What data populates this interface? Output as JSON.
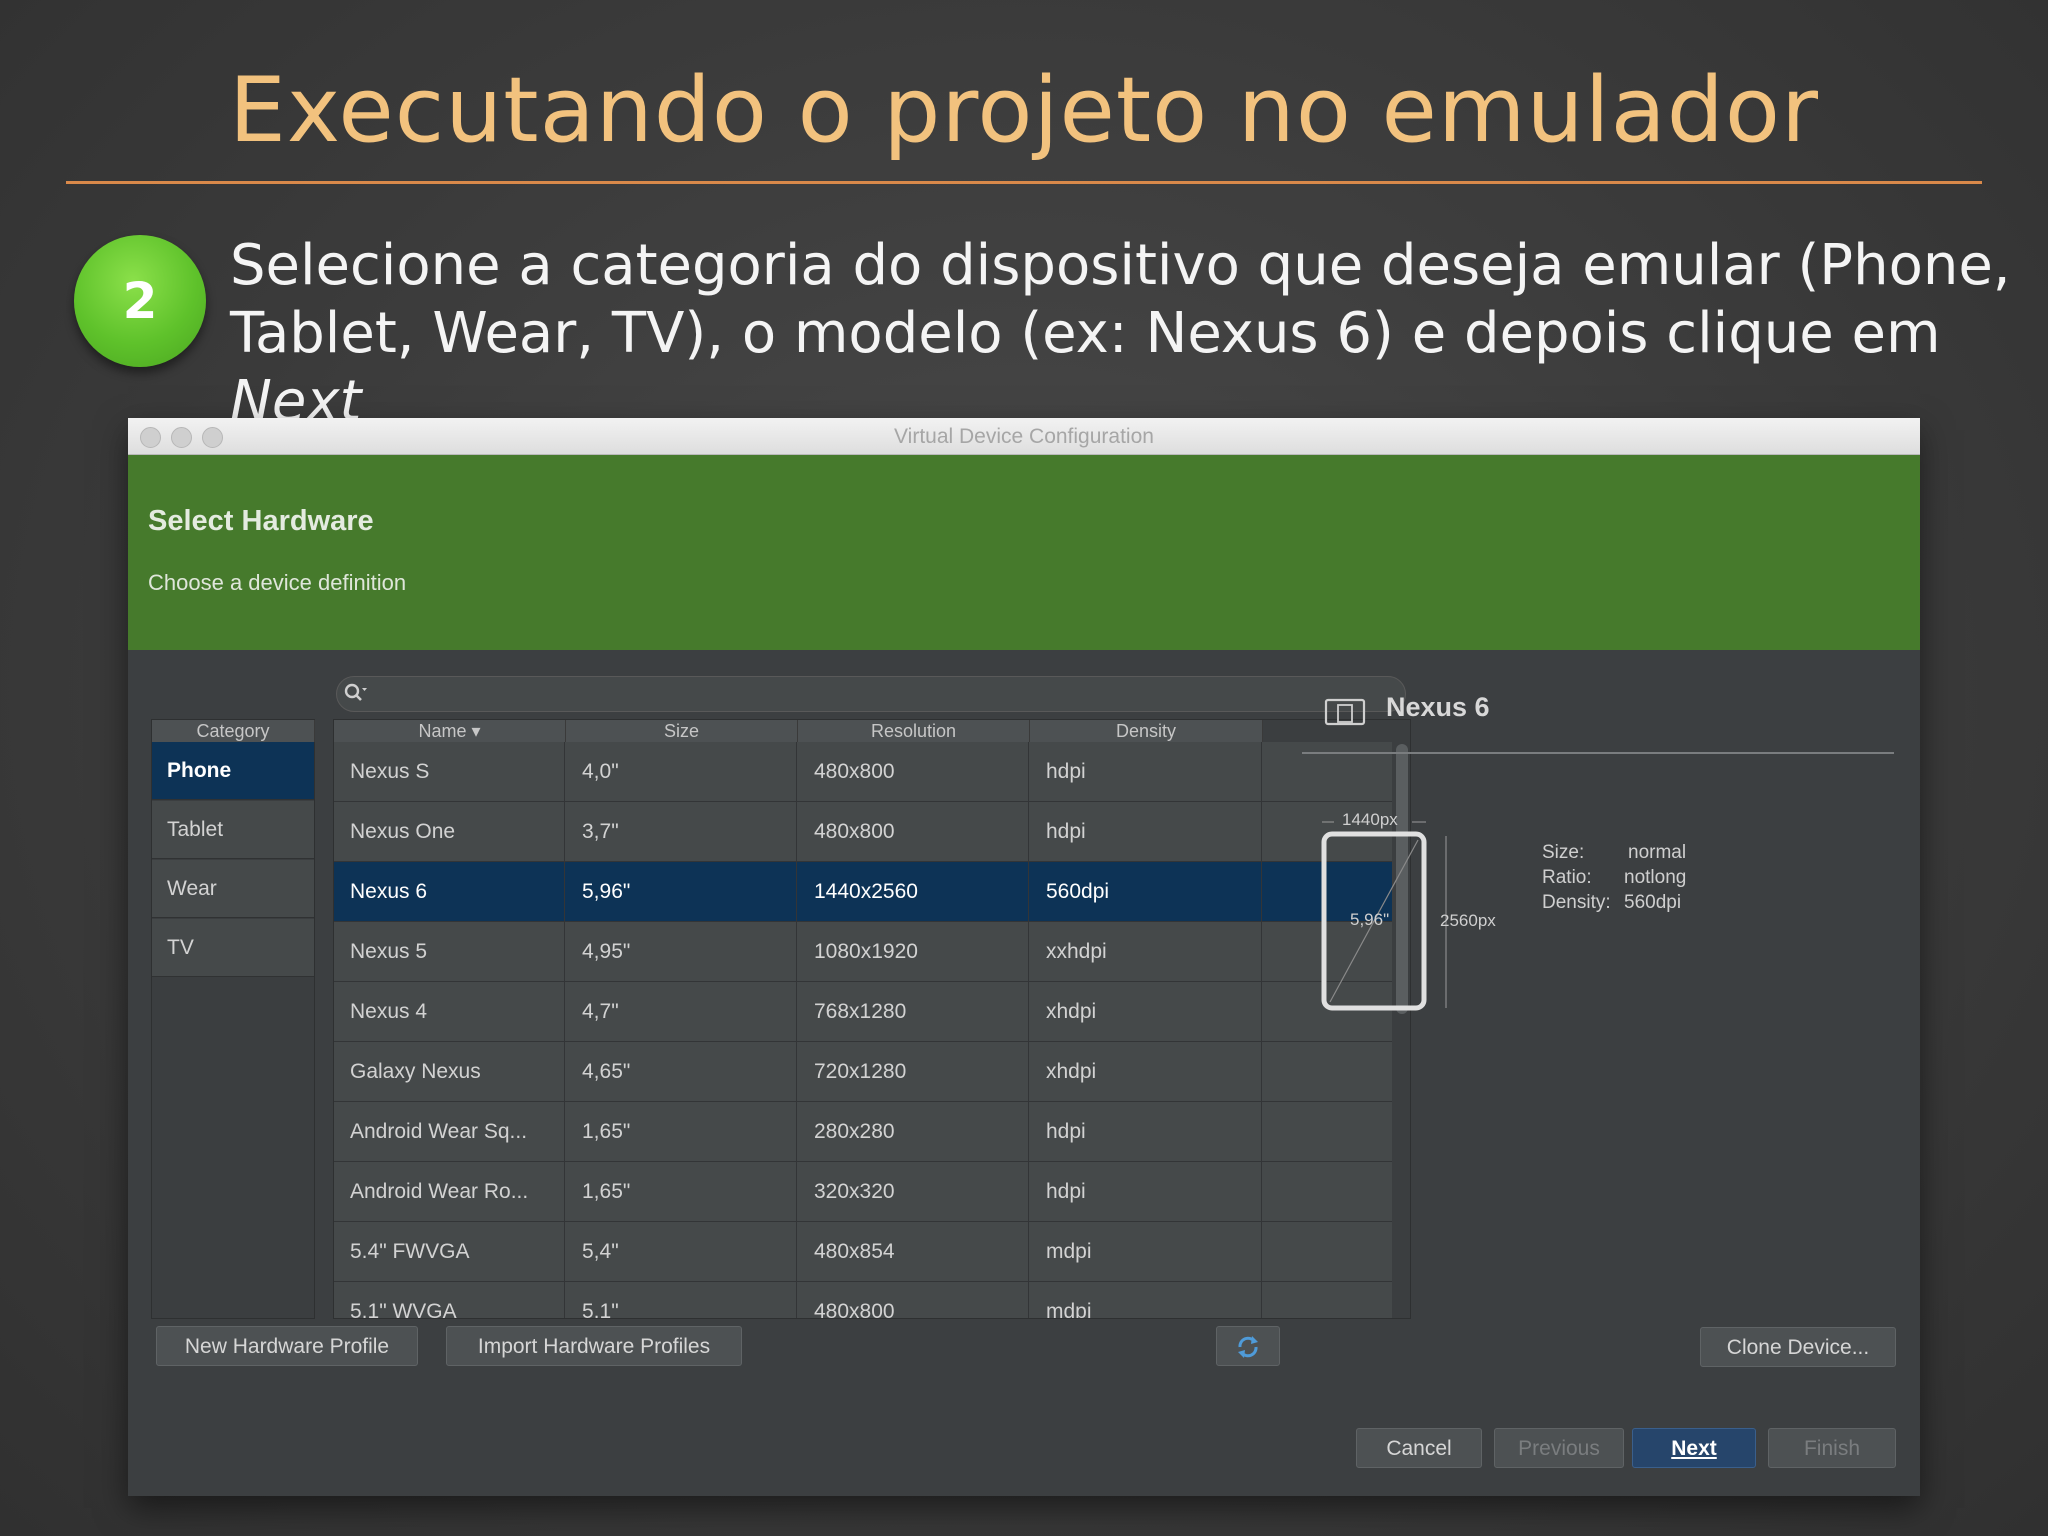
{
  "slide": {
    "title": "Executando o projeto no emulador",
    "step_number": "2",
    "instruction_part1": "Selecione a categoria do dispositivo que deseja emular (Phone, Tablet, Wear, TV), o modelo  (ex: Nexus 6) e depois clique em ",
    "instruction_emphasis": "Next"
  },
  "window": {
    "title": "Virtual Device Configuration",
    "header_title": "Select Hardware",
    "header_subtitle": "Choose a device definition"
  },
  "search": {
    "placeholder": ""
  },
  "category": {
    "header": "Category",
    "items": [
      "Phone",
      "Tablet",
      "Wear",
      "TV"
    ],
    "selected": "Phone"
  },
  "table": {
    "columns": [
      "Name ▾",
      "Size",
      "Resolution",
      "Density"
    ],
    "rows": [
      {
        "name": "Nexus S",
        "size": "4,0\"",
        "resolution": "480x800",
        "density": "hdpi"
      },
      {
        "name": "Nexus One",
        "size": "3,7\"",
        "resolution": "480x800",
        "density": "hdpi"
      },
      {
        "name": "Nexus 6",
        "size": "5,96\"",
        "resolution": "1440x2560",
        "density": "560dpi",
        "selected": true
      },
      {
        "name": "Nexus 5",
        "size": "4,95\"",
        "resolution": "1080x1920",
        "density": "xxhdpi"
      },
      {
        "name": "Nexus 4",
        "size": "4,7\"",
        "resolution": "768x1280",
        "density": "xhdpi"
      },
      {
        "name": "Galaxy Nexus",
        "size": "4,65\"",
        "resolution": "720x1280",
        "density": "xhdpi"
      },
      {
        "name": "Android Wear Sq...",
        "size": "1,65\"",
        "resolution": "280x280",
        "density": "hdpi"
      },
      {
        "name": "Android Wear Ro...",
        "size": "1,65\"",
        "resolution": "320x320",
        "density": "hdpi"
      },
      {
        "name": "5.4\" FWVGA",
        "size": "5,4\"",
        "resolution": "480x854",
        "density": "mdpi"
      },
      {
        "name": "5.1\" WVGA",
        "size": "5,1\"",
        "resolution": "480x800",
        "density": "mdpi"
      }
    ]
  },
  "buttons": {
    "new_profile": "New Hardware Profile",
    "import_profiles": "Import Hardware Profiles",
    "clone": "Clone Device...",
    "cancel": "Cancel",
    "previous": "Previous",
    "next": "Next",
    "finish": "Finish"
  },
  "detail": {
    "device_name": "Nexus 6",
    "width_label": "1440px",
    "height_label": "2560px",
    "diag_label": "5,96\"",
    "size_key": "Size:",
    "size_val": "normal",
    "ratio_key": "Ratio:",
    "ratio_val": "notlong",
    "density_key": "Density:",
    "density_val": "560dpi"
  },
  "colors": {
    "title": "#f2c27e",
    "badge": "#5fc22b",
    "header_green": "#467a2c",
    "selection": "#0d3356"
  }
}
